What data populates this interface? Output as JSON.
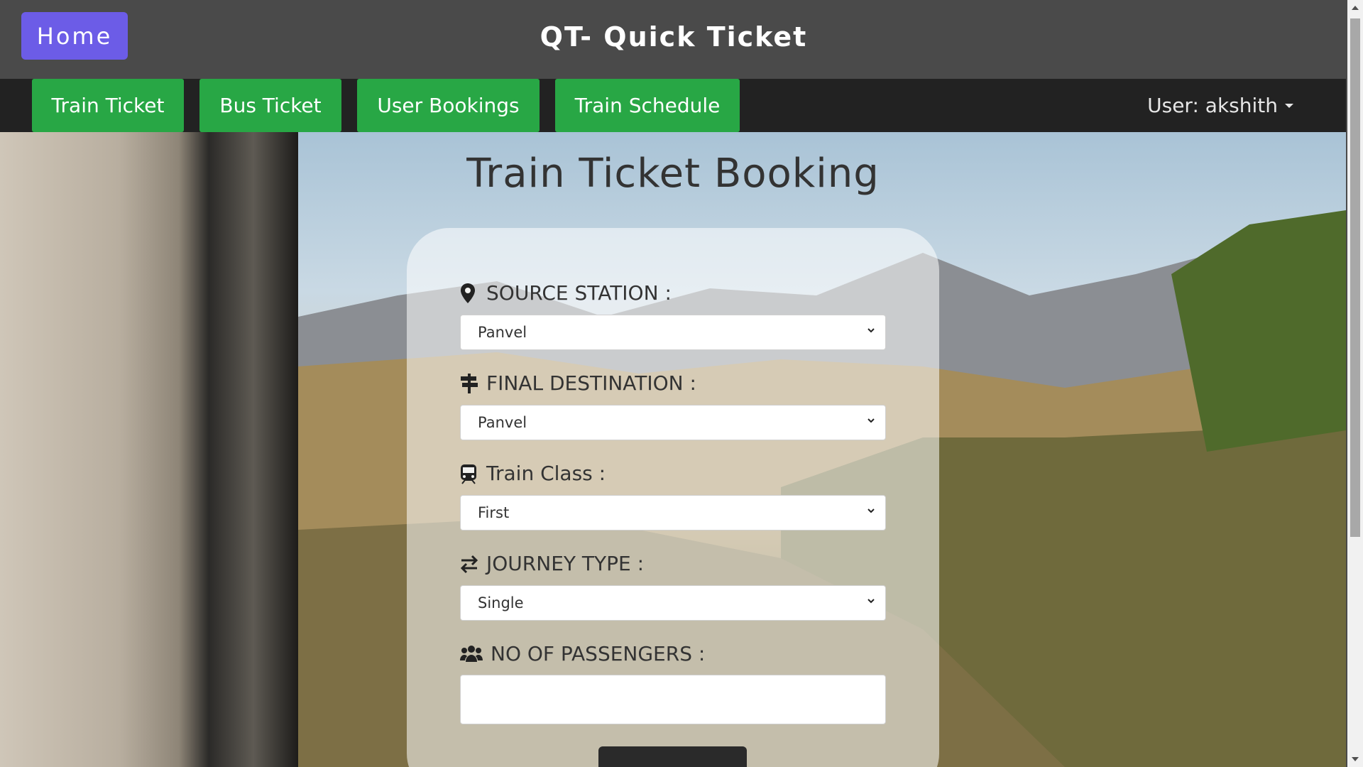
{
  "header": {
    "home_label": "Home",
    "site_title": "QT- Quick Ticket"
  },
  "nav": {
    "items": [
      {
        "label": "Train Ticket"
      },
      {
        "label": "Bus Ticket"
      },
      {
        "label": "User Bookings"
      },
      {
        "label": "Train Schedule"
      }
    ],
    "user_label": "User: akshith"
  },
  "booking": {
    "title": "Train Ticket Booking",
    "source": {
      "label": "SOURCE STATION :",
      "value": "Panvel",
      "icon": "map-marker-icon"
    },
    "destination": {
      "label": "FINAL DESTINATION :",
      "value": "Panvel",
      "icon": "signpost-icon"
    },
    "train_class": {
      "label": "Train Class :",
      "value": "First",
      "icon": "train-icon"
    },
    "journey_type": {
      "label": "JOURNEY TYPE :",
      "value": "Single",
      "icon": "exchange-arrows-icon"
    },
    "passengers": {
      "label": "NO OF PASSENGERS :",
      "value": "",
      "icon": "users-icon"
    }
  },
  "colors": {
    "header_bg": "#4a4a4a",
    "navbar_bg": "#222222",
    "home_button": "#6c5ce7",
    "nav_button": "#28a745"
  }
}
